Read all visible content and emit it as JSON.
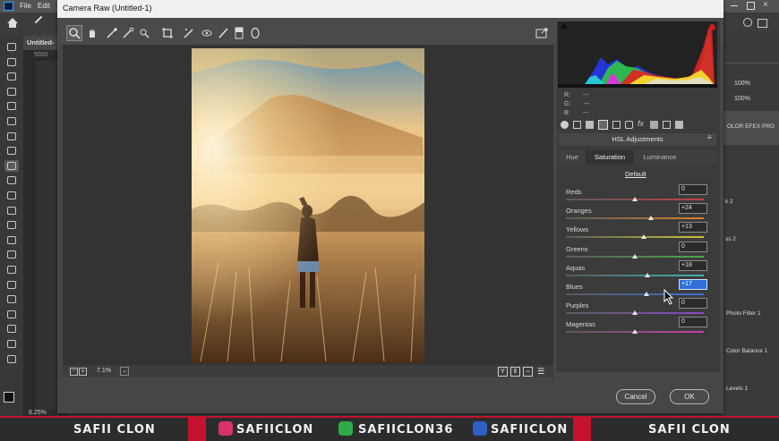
{
  "photoshop": {
    "menu": [
      "File",
      "Edit"
    ],
    "doc_tab": "Untitled-",
    "ruler_value": "5000",
    "zoom_status": "6.25%",
    "right_panel": {
      "zoom_a": "100%",
      "zoom_b": "100%",
      "layers": [
        "OLOR EFEX PRO",
        "k 2",
        "ss 2",
        "Photo Filter 1",
        "Color Balance 1",
        "Levels 1"
      ]
    }
  },
  "camera_raw": {
    "title": "Camera Raw (Untitled-1)",
    "rgb": {
      "r_label": "R:",
      "g_label": "G:",
      "b_label": "B:",
      "r": "---",
      "g": "---",
      "b": "---"
    },
    "panel_title": "HSL Adjustments",
    "tabs": [
      {
        "label": "Hue",
        "active": false
      },
      {
        "label": "Saturation",
        "active": true
      },
      {
        "label": "Luminance",
        "active": false
      }
    ],
    "default_link": "Default",
    "sliders": [
      {
        "label": "Reds",
        "value": "0",
        "pos": 0.5,
        "color": "#c64040"
      },
      {
        "label": "Oranges",
        "value": "+24",
        "pos": 0.62,
        "color": "#d9822b"
      },
      {
        "label": "Yellows",
        "value": "+13",
        "pos": 0.565,
        "color": "#cfc43a"
      },
      {
        "label": "Greens",
        "value": "0",
        "pos": 0.5,
        "color": "#4aa84a"
      },
      {
        "label": "Aquas",
        "value": "+18",
        "pos": 0.59,
        "color": "#3bb5b0"
      },
      {
        "label": "Blues",
        "value": "+17",
        "pos": 0.585,
        "color": "#3b6fd9"
      },
      {
        "label": "Purples",
        "value": "0",
        "pos": 0.5,
        "color": "#8a4cc9"
      },
      {
        "label": "Magentas",
        "value": "0",
        "pos": 0.5,
        "color": "#c93fa6"
      }
    ],
    "zoom": "7.1%",
    "cancel_label": "Cancel",
    "ok_label": "OK"
  },
  "banner": {
    "left_name": "SAFII CLON",
    "instagram": "SAFIICLON",
    "other": "SAFIICLON36",
    "facebook": "SAFIICLON",
    "right_name": "SAFII CLON",
    "colors": {
      "instagram": "#d6336c",
      "other": "#2eaa4a",
      "facebook": "#2d5fc4",
      "accent": "#c4122f"
    }
  }
}
